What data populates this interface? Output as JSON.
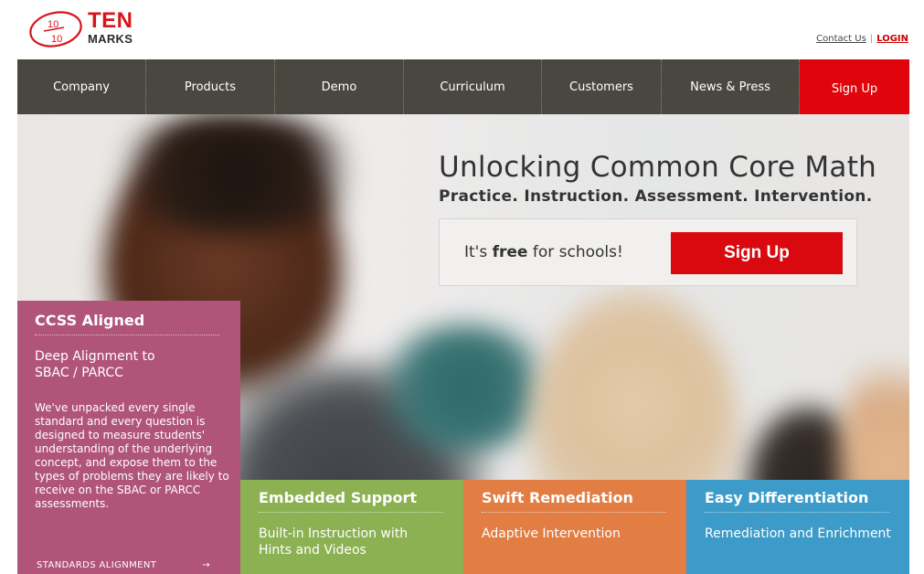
{
  "logo": {
    "ten": "TEN",
    "marks": "MARKS",
    "fraction_top": "10",
    "fraction_bottom": "10"
  },
  "toplinks": {
    "contact": "Contact Us",
    "separator": "|",
    "login": "LOGIN"
  },
  "nav": {
    "items": [
      {
        "label": "Company"
      },
      {
        "label": "Products"
      },
      {
        "label": "Demo"
      },
      {
        "label": "Curriculum"
      },
      {
        "label": "Customers"
      },
      {
        "label": "News & Press"
      }
    ],
    "signup": "Sign Up"
  },
  "hero": {
    "headline": "Unlocking Common Core Math",
    "subline": "Practice. Instruction. Assessment. Intervention.",
    "cta_prefix": "It's ",
    "cta_bold": "free",
    "cta_suffix": " for schools!",
    "cta_button": "Sign Up"
  },
  "panels": {
    "ccss": {
      "title": "CCSS Aligned",
      "subtitle": "Deep Alignment to SBAC / PARCC",
      "body": "We've unpacked every single standard and every question is designed to measure students' understanding of the underlying concept, and expose them to the types of problems they are likely to receive on the SBAC or PARCC assessments.",
      "link": "STANDARDS ALIGNMENT",
      "link_arrow": "→"
    },
    "embedded": {
      "title": "Embedded Support",
      "subtitle": "Built-in Instruction with Hints and Videos"
    },
    "swift": {
      "title": "Swift Remediation",
      "subtitle": "Adaptive Intervention"
    },
    "easy": {
      "title": "Easy Differentiation",
      "subtitle": "Remediation and Enrichment"
    }
  },
  "colors": {
    "brand_red": "#d8141c",
    "nav_bg": "#4a4740",
    "ccss_panel": "#b0547a",
    "embedded_panel": "#8cb153",
    "swift_panel": "#e27d43",
    "easy_panel": "#3d9bc9"
  },
  "icons": [
    "arrow-right-icon",
    "tenmarks-logo-oval"
  ]
}
